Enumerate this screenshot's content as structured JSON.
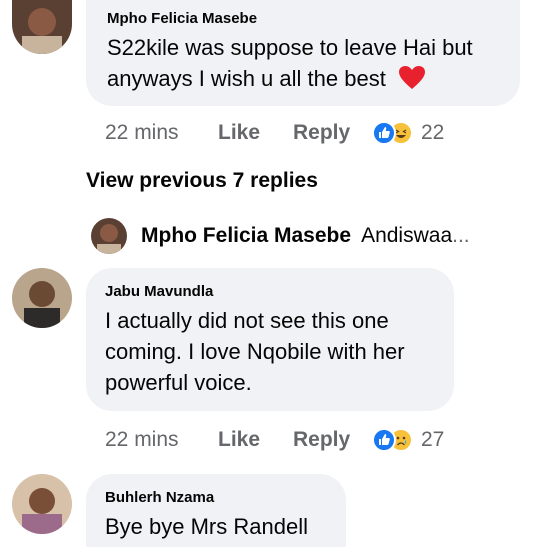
{
  "comments": [
    {
      "author": "Mpho Felicia Masebe",
      "lines": [
        "S22kile was suppose to leave Hai but",
        "anyways I wish u all the best"
      ],
      "emoji": "red-heart",
      "time": "22 mins",
      "like_label": "Like",
      "reply_label": "Reply",
      "reactions": [
        "like-icon",
        "laughing-emoji-icon"
      ],
      "reaction_count": "22"
    },
    {
      "author": "Jabu Mavundla",
      "lines": [
        "I actually did not see this one",
        "coming. I love Nqobile with her",
        "powerful voice."
      ],
      "time": "22 mins",
      "like_label": "Like",
      "reply_label": "Reply",
      "reactions": [
        "like-icon",
        "sad-emoji-icon"
      ],
      "reaction_count": "27"
    },
    {
      "author": "Buhlerh Nzama",
      "lines": [
        "Bye bye Mrs Randell"
      ]
    }
  ],
  "view_previous": "View previous 7 replies",
  "reply_preview": {
    "name": "Mpho Felicia Masebe",
    "snippet": "Andiswaa",
    "ellipsis": "..."
  },
  "colors": {
    "bubble": "#f0f2f5",
    "meta": "#65676b",
    "like_blue": "#1877f2",
    "heart": "#e8212e"
  }
}
